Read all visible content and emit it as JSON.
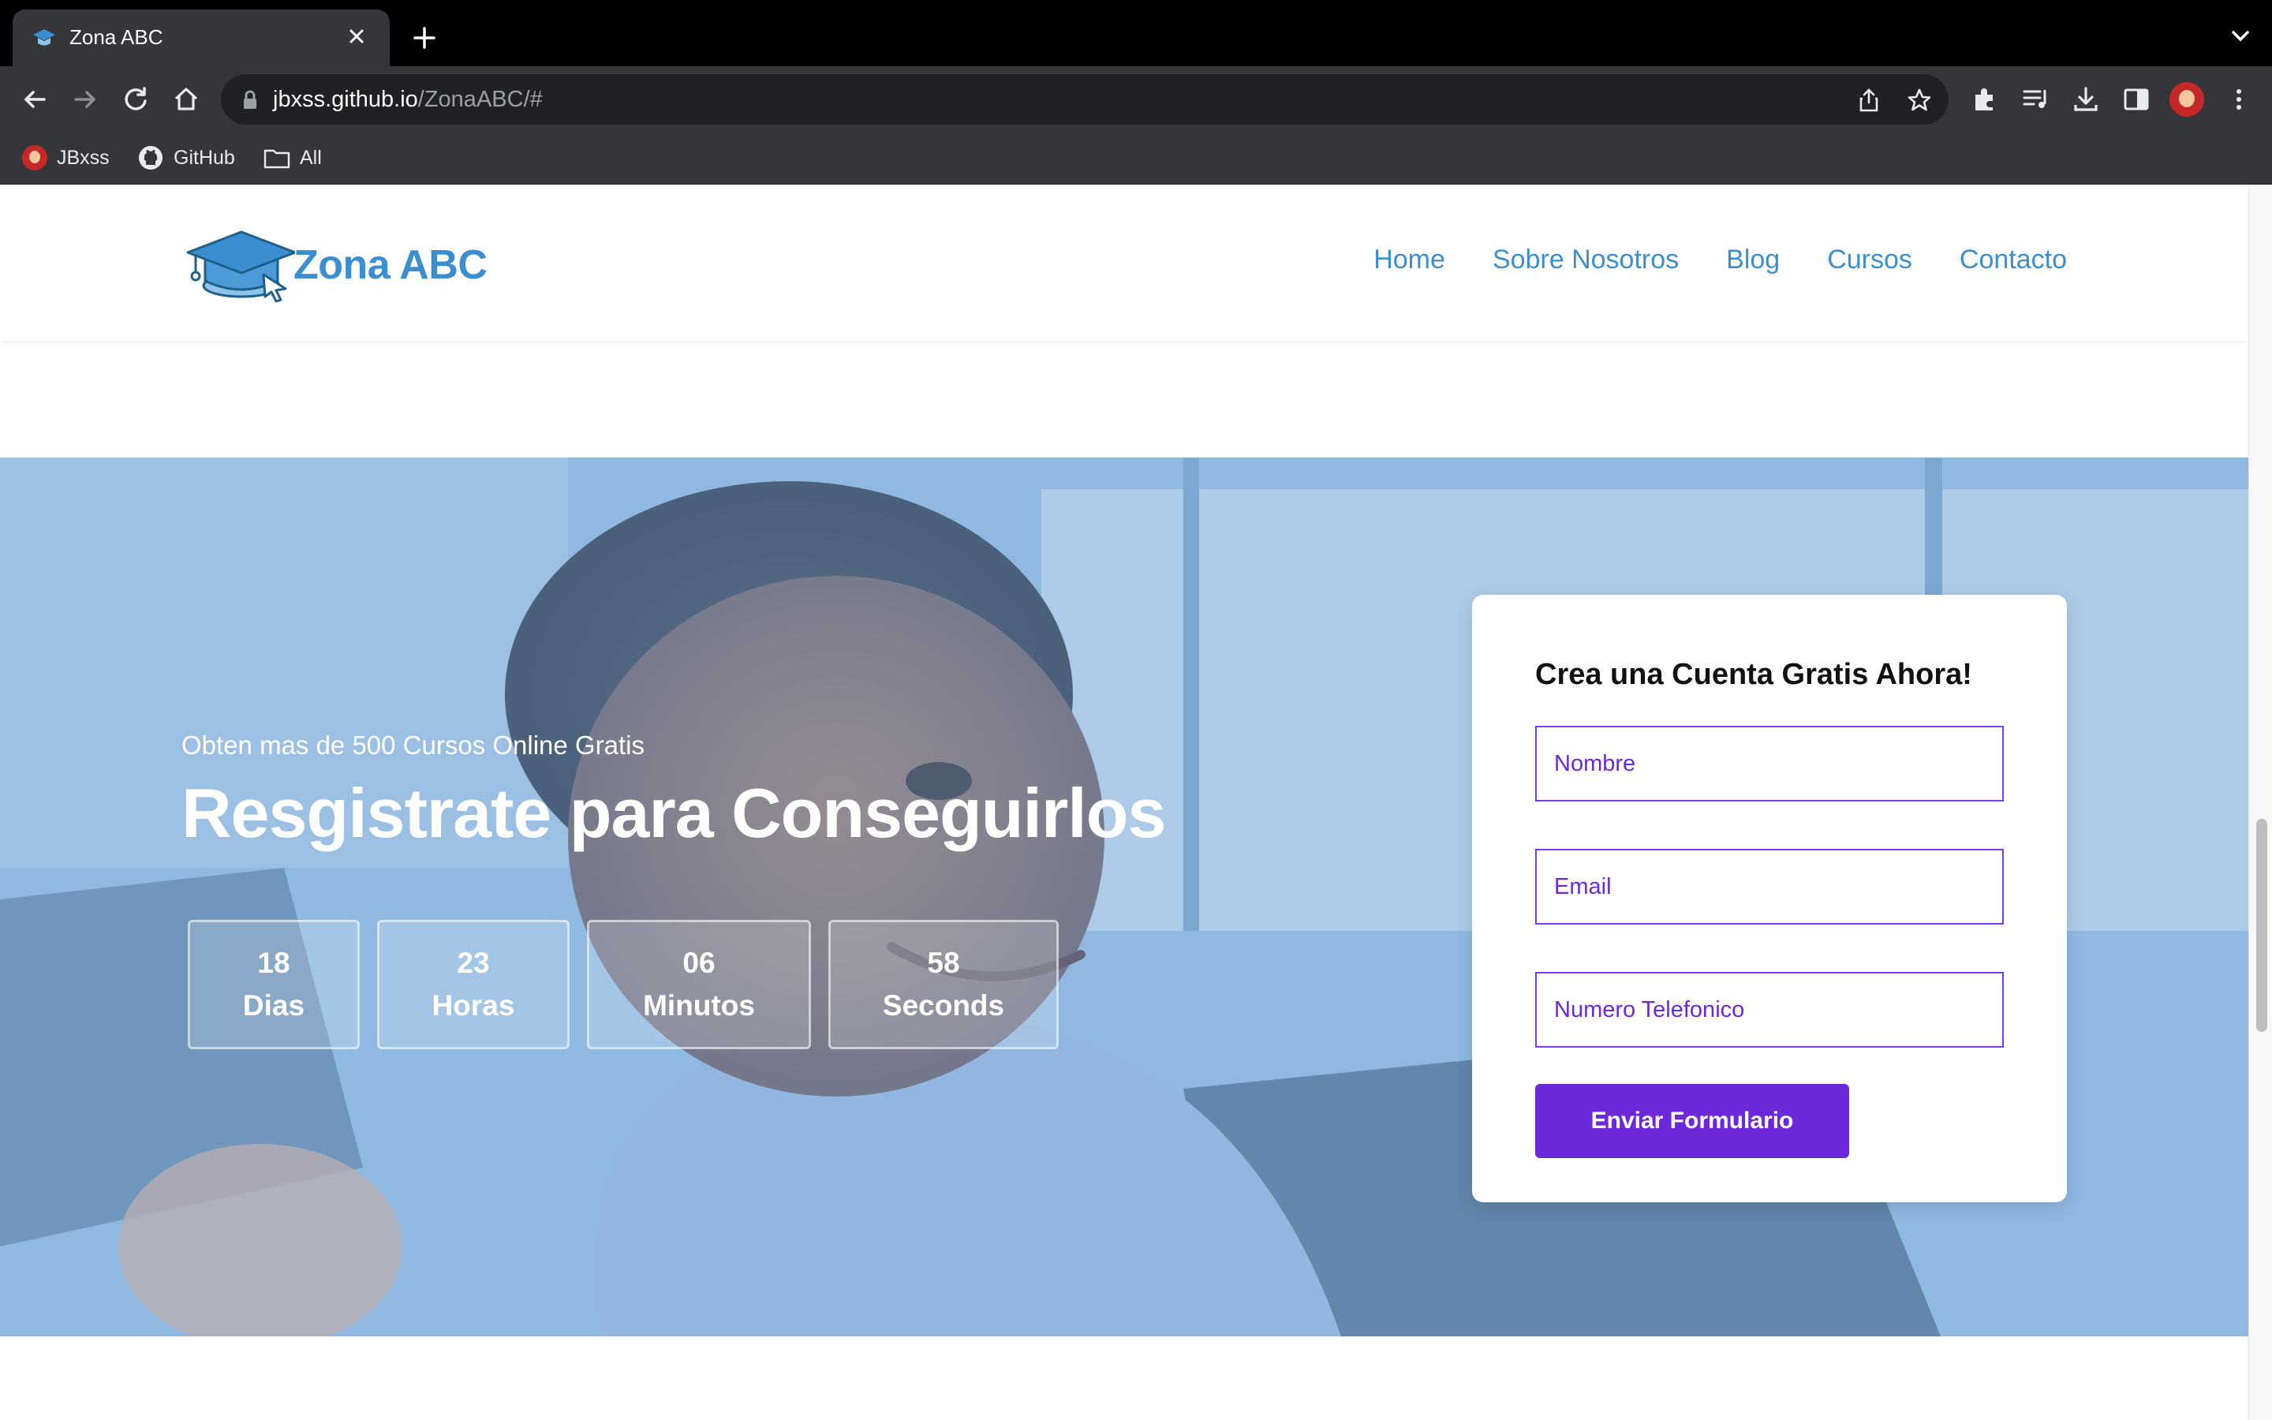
{
  "browser": {
    "tab_title": "Zona ABC",
    "url_host": "jbxss.github.io",
    "url_path": "/ZonaABC/#",
    "bookmarks": [
      {
        "label": "JBxss",
        "icon": "avatar-icon"
      },
      {
        "label": "GitHub",
        "icon": "github-icon"
      },
      {
        "label": "All",
        "icon": "folder-icon"
      }
    ]
  },
  "site": {
    "logo_text": "Zona ABC",
    "nav": [
      "Home",
      "Sobre Nosotros",
      "Blog",
      "Cursos",
      "Contacto"
    ]
  },
  "hero": {
    "subtitle": "Obten mas de 500 Cursos Online Gratis",
    "title": "Resgistrate para Conseguirlos",
    "countdown": [
      {
        "value": "18",
        "unit": "Dias"
      },
      {
        "value": "23",
        "unit": "Horas"
      },
      {
        "value": "06",
        "unit": "Minutos"
      },
      {
        "value": "58",
        "unit": "Seconds"
      }
    ]
  },
  "form": {
    "title": "Crea una Cuenta Gratis Ahora!",
    "name_placeholder": "Nombre",
    "email_placeholder": "Email",
    "phone_placeholder": "Numero Telefonico",
    "submit_label": "Enviar Formulario"
  },
  "colors": {
    "brand_blue": "#3b8fd0",
    "accent_purple": "#6d28d9"
  }
}
